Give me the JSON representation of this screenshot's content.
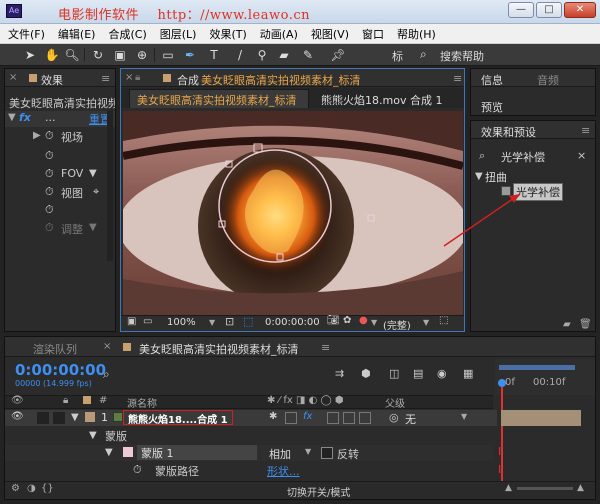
{
  "watermark": "电影制作软件    http：//www.leawo.cn",
  "window": {
    "minimize": "—",
    "maximize": "□",
    "close": "✕"
  },
  "menu": [
    "文件(F)",
    "编辑(E)",
    "合成(C)",
    "图层(L)",
    "效果(T)",
    "动画(A)",
    "视图(V)",
    "窗口",
    "帮助(H)"
  ],
  "toolbar": {
    "workspace": "标",
    "search_label": "搜索帮助"
  },
  "left_panel": {
    "tab": "效果",
    "layer_title": "美女眨眼高清实拍视频",
    "fx_label": "fx",
    "fx_name": "...",
    "reset": "重置",
    "props": [
      "视场",
      "",
      "FOV",
      "视图",
      "",
      "调整"
    ]
  },
  "comp_panel": {
    "tab_prefix": "合成",
    "tab_name": "美女眨眼高清实拍视频素材_标清",
    "subtab1": "美女眨眼高清实拍视频素材_标清",
    "subtab2": "熊熊火焰18.mov 合成 1",
    "zoom": "100%",
    "timecode": "0:00:00:00",
    "resolution": "(完整)"
  },
  "info_panel": {
    "tab_info": "信息",
    "tab_audio": "音频",
    "tab_preview": "预览"
  },
  "effects_panel": {
    "tab": "效果和预设",
    "search_value": "光学补偿",
    "category": "扭曲",
    "item": "光学补偿"
  },
  "timeline": {
    "tab_render": "渲染队列",
    "tab_comp": "美女眨眼高清实拍视频素材_标清",
    "timecode": "0:00:00:00",
    "frames": "00000 (14.999 fps)",
    "col_hash": "#",
    "col_source": "源名称",
    "col_parent": "父级",
    "layer_num": "1",
    "layer_name": "熊熊火焰18....合成 1",
    "parent_value": "无",
    "masks_label": "蒙版",
    "mask1_label": "蒙版 1",
    "mask_mode": "相加",
    "invert_label": "反转",
    "mask_path_label": "蒙版路径",
    "mask_path_value": "形状...",
    "ruler_start": "0f",
    "ruler_mid": "00:10f",
    "toggle_label": "切换开关/模式"
  },
  "colors": {
    "accent_blue": "#3d8ff0",
    "tab_orange": "#e8a64a",
    "watermark_red": "#e03020",
    "annotation_red": "#d02020"
  }
}
